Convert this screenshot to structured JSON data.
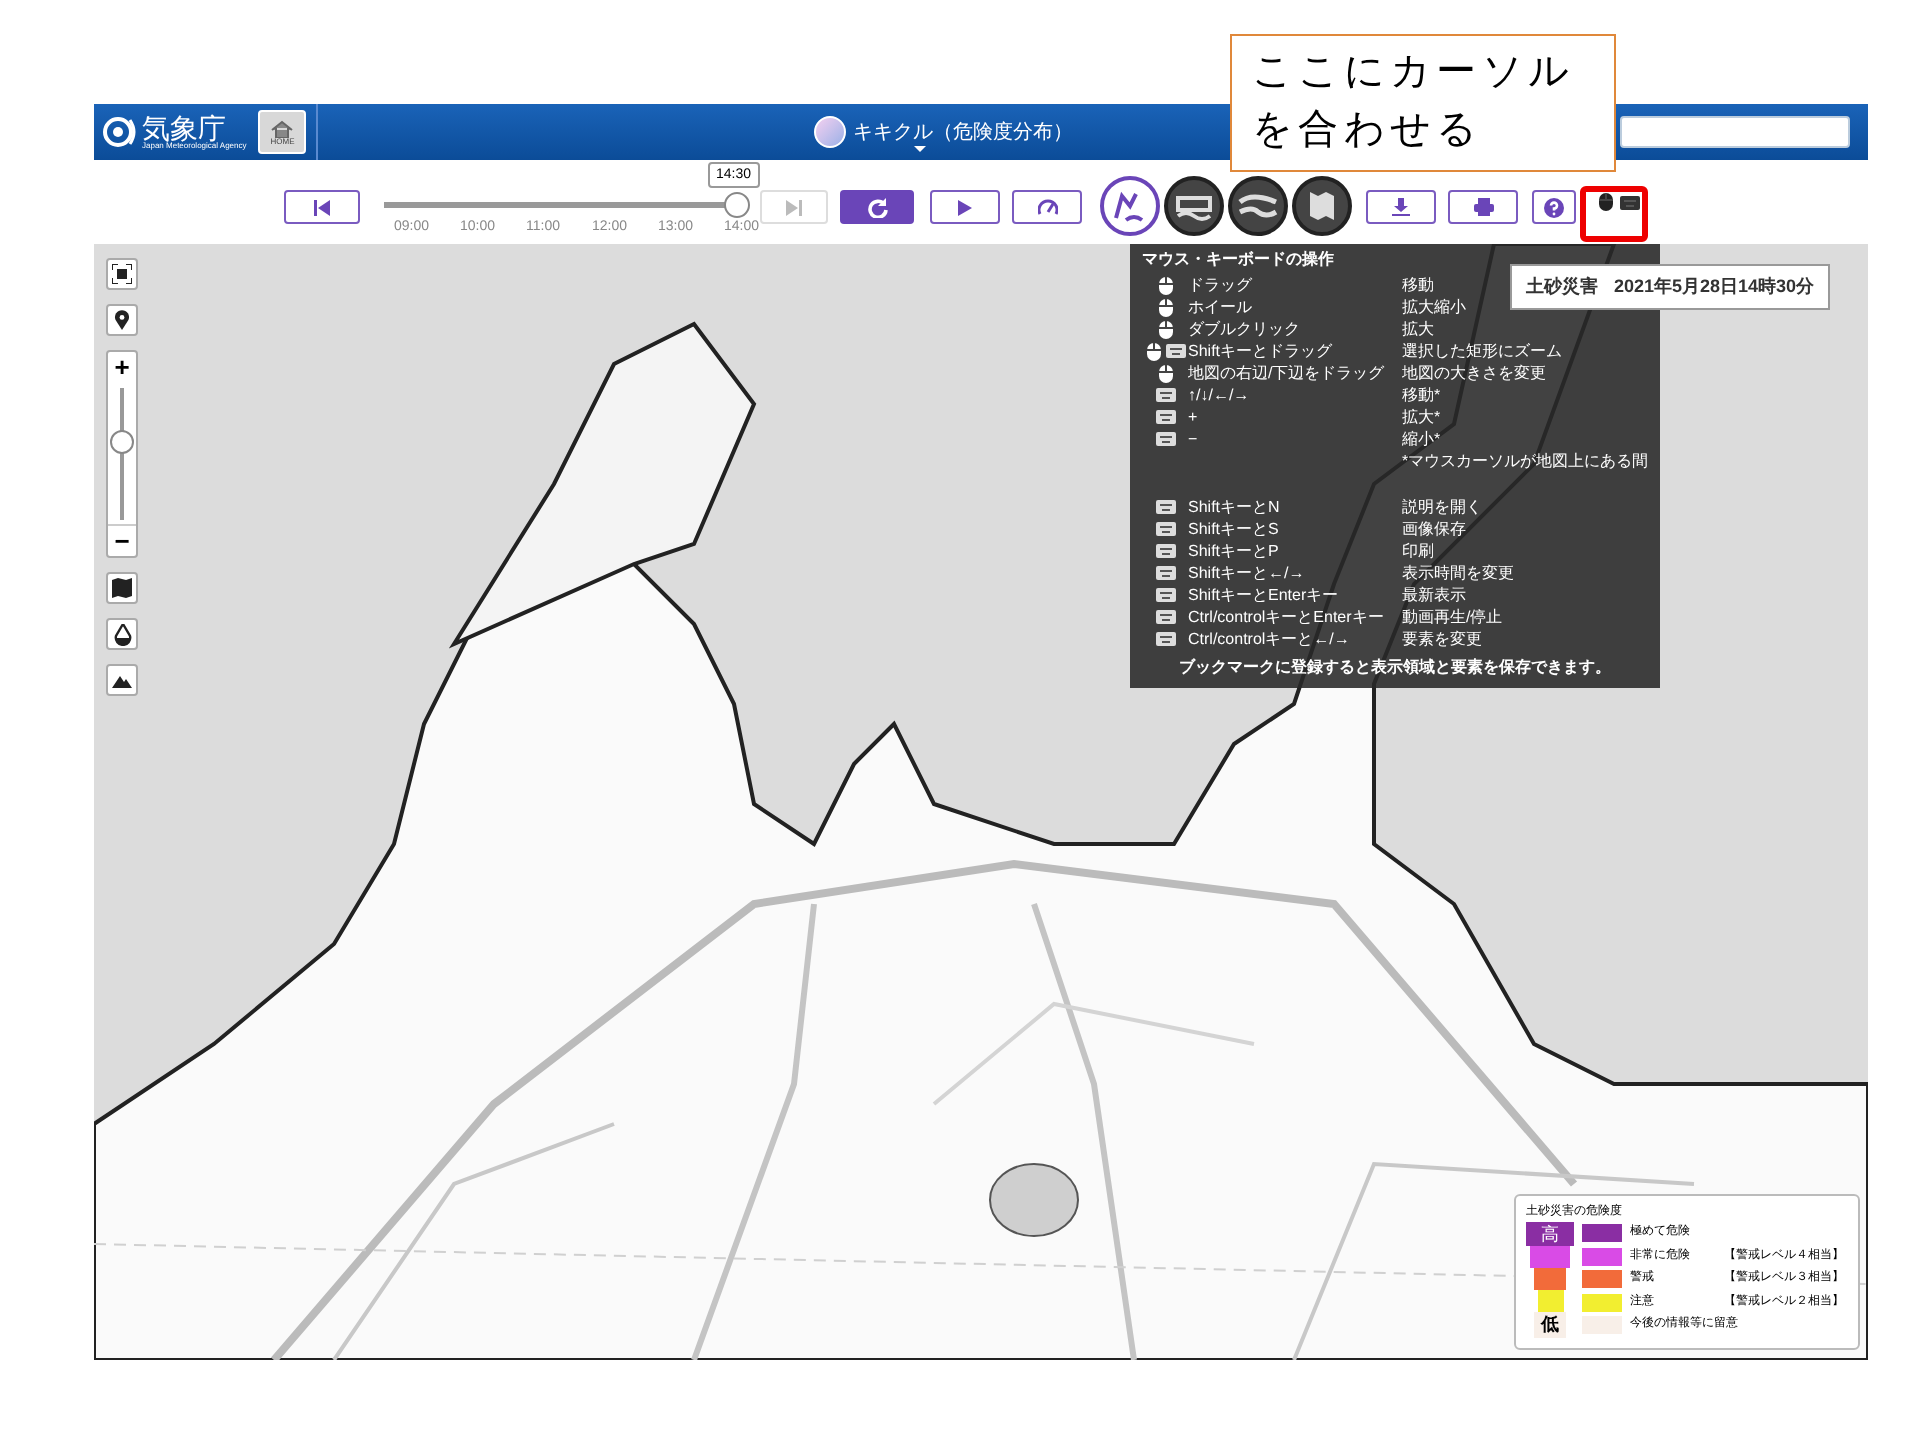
{
  "callout": {
    "lines": [
      "ここにカーソル",
      "を合わせる"
    ],
    "highlight_on": true
  },
  "header": {
    "logo_text": "気象庁",
    "logo_subtitle": "Japan Meteorological Agency",
    "home_label": "HOME",
    "title": "キキクル（危険度分布）"
  },
  "timeline": {
    "tooltip": "14:30",
    "level": 1,
    "ticks": [
      "09:00",
      "10:00",
      "11:00",
      "12:00",
      "13:00",
      "14:00"
    ]
  },
  "layers": [
    {
      "kind": "landslide",
      "selected": true
    },
    {
      "kind": "inundation",
      "selected": false
    },
    {
      "kind": "flood",
      "selected": false
    },
    {
      "kind": "map",
      "selected": false
    }
  ],
  "help": {
    "title": "マウス・キーボードの操作",
    "mouse_rows": [
      {
        "kind": "mouse",
        "action": "ドラッグ",
        "result": "移動"
      },
      {
        "kind": "mouse",
        "action": "ホイール",
        "result": "拡大縮小"
      },
      {
        "kind": "mouse",
        "action": "ダブルクリック",
        "result": "拡大"
      },
      {
        "kind": "mouse_keyboard",
        "action": "Shiftキーとドラッグ",
        "result": "選択した矩形にズーム"
      },
      {
        "kind": "mouse",
        "action": "地図の右辺/下辺をドラッグ",
        "result": "地図の大きさを変更"
      },
      {
        "kind": "keyboard",
        "action": "↑/↓/←/→",
        "result": "移動*"
      },
      {
        "kind": "keyboard",
        "action": "+",
        "result": "拡大*"
      },
      {
        "kind": "keyboard",
        "action": "−",
        "result": "縮小*"
      }
    ],
    "note": "*マウスカーソルが地図上にある間",
    "key_rows": [
      {
        "kind": "keyboard",
        "action": "ShiftキーとN",
        "result": "説明を開く"
      },
      {
        "kind": "keyboard",
        "action": "ShiftキーとS",
        "result": "画像保存"
      },
      {
        "kind": "keyboard",
        "action": "ShiftキーとP",
        "result": "印刷"
      },
      {
        "kind": "keyboard",
        "action": "Shiftキーと←/→",
        "result": "表示時間を変更"
      },
      {
        "kind": "keyboard",
        "action": "ShiftキーとEnterキー",
        "result": "最新表示"
      },
      {
        "kind": "keyboard",
        "action": "Ctrl/controlキーとEnterキー",
        "result": "動画再生/停止"
      },
      {
        "kind": "keyboard",
        "action": "Ctrl/controlキーと←/→",
        "result": "要素を変更"
      }
    ],
    "footer": "ブックマークに登録すると表示領域と要素を保存できます。"
  },
  "status": {
    "label": "土砂災害",
    "time": "2021年5月28日14時30分"
  },
  "zoom": {
    "level": 0.62,
    "in_label": "+",
    "out_label": "−"
  },
  "legend": {
    "title": "土砂災害の危険度",
    "high": "高",
    "low": "低",
    "items": [
      {
        "color": "#8a2ea3",
        "label": "極めて危険"
      },
      {
        "color": "#d94be6",
        "label": "非常に危険",
        "note": "【警戒レベル４相当】"
      },
      {
        "color": "#f26b3a",
        "label": "警戒",
        "note": "【警戒レベル３相当】"
      },
      {
        "color": "#f2ee30",
        "label": "注意",
        "note": "【警戒レベル２相当】"
      },
      {
        "color": "#f8efe8",
        "label": "今後の情報等に留意"
      }
    ]
  }
}
